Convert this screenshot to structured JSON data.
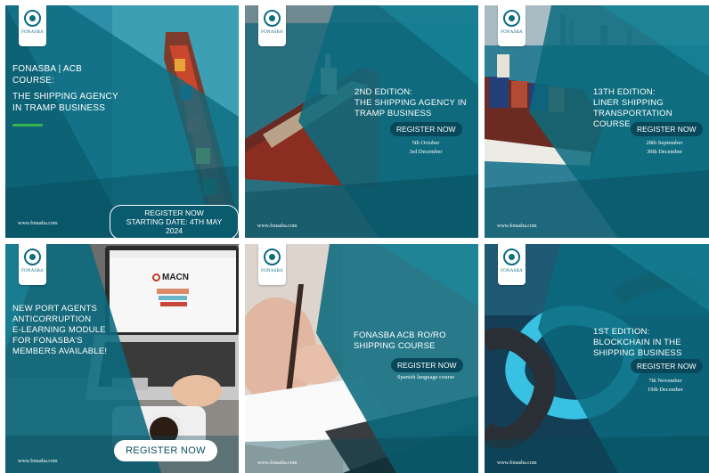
{
  "logo_name": "FONASBA",
  "url": "www.fonasba.com",
  "colors": {
    "accent": "#39b54a",
    "teal": "#0a5b6e",
    "button": "#08485a"
  },
  "tiles": [
    {
      "lines": [
        "FONASBA | ACB",
        "Course:",
        "The shipping agency",
        "in tramp business"
      ],
      "cta": [
        "Register now",
        "Starting date: 4th May 2024"
      ]
    },
    {
      "lines": [
        "2nd Edition:",
        "The shipping agency in",
        "tramp business"
      ],
      "button": "Register now",
      "dates": [
        "5th October",
        "3rd December"
      ]
    },
    {
      "lines": [
        "13th Edition:",
        "Liner Shipping",
        "Transportation Course"
      ],
      "button": "Register now",
      "dates": [
        "28th September",
        "30th December"
      ]
    },
    {
      "lines": [
        "New port agents",
        "anticorruption",
        "e-learning module",
        "for FONASBA's",
        "members available!"
      ],
      "button": "Register now",
      "screen_brand": "MACN"
    },
    {
      "lines": [
        "FONASBA ACB Ro/Ro",
        "Shipping Course"
      ],
      "button": "Register now",
      "note": "Spanish language course"
    },
    {
      "lines": [
        "1st Edition:",
        "Blockchain in the",
        "Shipping Business"
      ],
      "button": "Register now",
      "dates": [
        "7th November",
        "19th December"
      ]
    }
  ]
}
